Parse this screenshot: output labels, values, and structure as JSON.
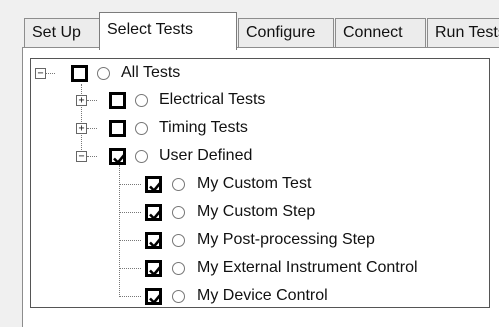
{
  "tabs": [
    {
      "label": "Set Up",
      "active": false
    },
    {
      "label": "Select Tests",
      "active": true
    },
    {
      "label": "Configure",
      "active": false
    },
    {
      "label": "Connect",
      "active": false
    },
    {
      "label": "Run Tests",
      "active": false
    }
  ],
  "tree": {
    "root": {
      "label": "All Tests",
      "checked": false,
      "expanded": true
    },
    "groups": [
      {
        "label": "Electrical Tests",
        "checked": false,
        "expanded": false
      },
      {
        "label": "Timing Tests",
        "checked": false,
        "expanded": false
      },
      {
        "label": "User Defined",
        "checked": true,
        "expanded": true
      }
    ],
    "user_defined_items": [
      {
        "label": "My Custom Test",
        "checked": true
      },
      {
        "label": "My Custom Step",
        "checked": true
      },
      {
        "label": "My Post-processing Step",
        "checked": true
      },
      {
        "label": "My External Instrument Control",
        "checked": true
      },
      {
        "label": "My Device Control",
        "checked": true
      }
    ]
  },
  "icons": {
    "expand": "plus-box-icon",
    "collapse": "minus-box-icon",
    "checkbox": "checkbox-icon",
    "radio": "radio-button-icon"
  }
}
